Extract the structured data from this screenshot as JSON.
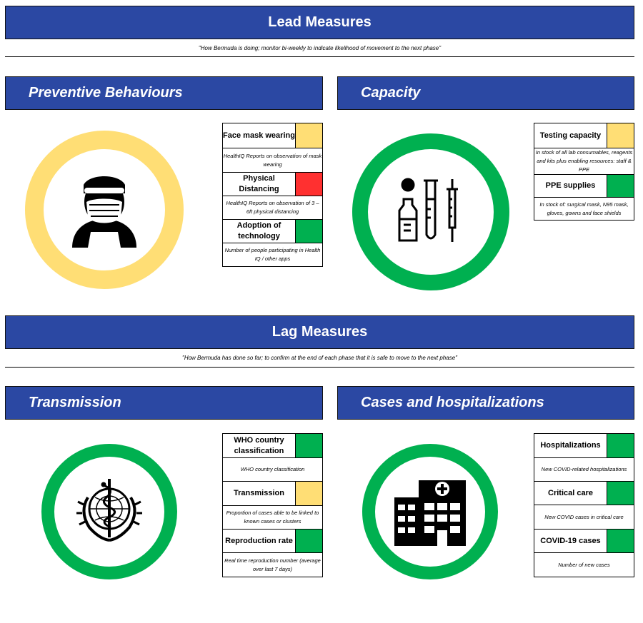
{
  "lead": {
    "title": "Lead Measures",
    "subtitle": "\"How Bermuda is doing; monitor bi-weekly to indicate likelihood of movement to the next phase\""
  },
  "lag": {
    "title": "Lag Measures",
    "subtitle": "\"How Bermuda has done so far; to confirm at the end of each phase that it is safe to move to the next phase\""
  },
  "colors": {
    "banner": "#2b48a3",
    "yellow": "#ffde75",
    "red": "#ff3030",
    "green": "#00b050"
  },
  "sections": {
    "preventive": {
      "title": "Preventive Behaviours",
      "ring_status": "yellow",
      "icon": "masked-person-icon",
      "metrics": [
        {
          "label": "Face mask wearing",
          "status": "yellow",
          "desc": "HealthIQ Reports on observation of mask wearing"
        },
        {
          "label": "Physical Distancing",
          "status": "red",
          "desc": "HealthIQ Reports on observation of 3 – 6ft physical distancing"
        },
        {
          "label": "Adoption of technology",
          "status": "green",
          "desc": "Number of people participating in Health IQ / other apps"
        }
      ]
    },
    "capacity": {
      "title": "Capacity",
      "ring_status": "green",
      "icon": "lab-supplies-icon",
      "metrics": [
        {
          "label": "Testing capacity",
          "status": "yellow",
          "desc": "In stock of all lab consumables, reagents and kits plus enabling resources: staff & PPE"
        },
        {
          "label": "PPE supplies",
          "status": "green",
          "desc": "In stock of: surgical mask, N95 mask, gloves, gowns and face shields"
        }
      ]
    },
    "transmission": {
      "title": "Transmission",
      "ring_status": "green",
      "icon": "who-emblem-icon",
      "metrics": [
        {
          "label": "WHO country classification",
          "status": "green",
          "desc": "WHO country classification"
        },
        {
          "label": "Transmission",
          "status": "yellow",
          "desc": "Proportion of cases able to be linked to known cases or clusters"
        },
        {
          "label": "Reproduction rate",
          "status": "green",
          "desc": "Real time reproduction number (average over last 7 days)"
        }
      ]
    },
    "cases": {
      "title": "Cases and hospitalizations",
      "ring_status": "green",
      "icon": "hospital-icon",
      "metrics": [
        {
          "label": "Hospitalizations",
          "status": "green",
          "desc": "New COVID-related hospitalizations"
        },
        {
          "label": "Critical care",
          "status": "green",
          "desc": "New COVID cases in critical care"
        },
        {
          "label": "COVID-19 cases",
          "status": "green",
          "desc": "Number of new cases"
        }
      ]
    }
  }
}
